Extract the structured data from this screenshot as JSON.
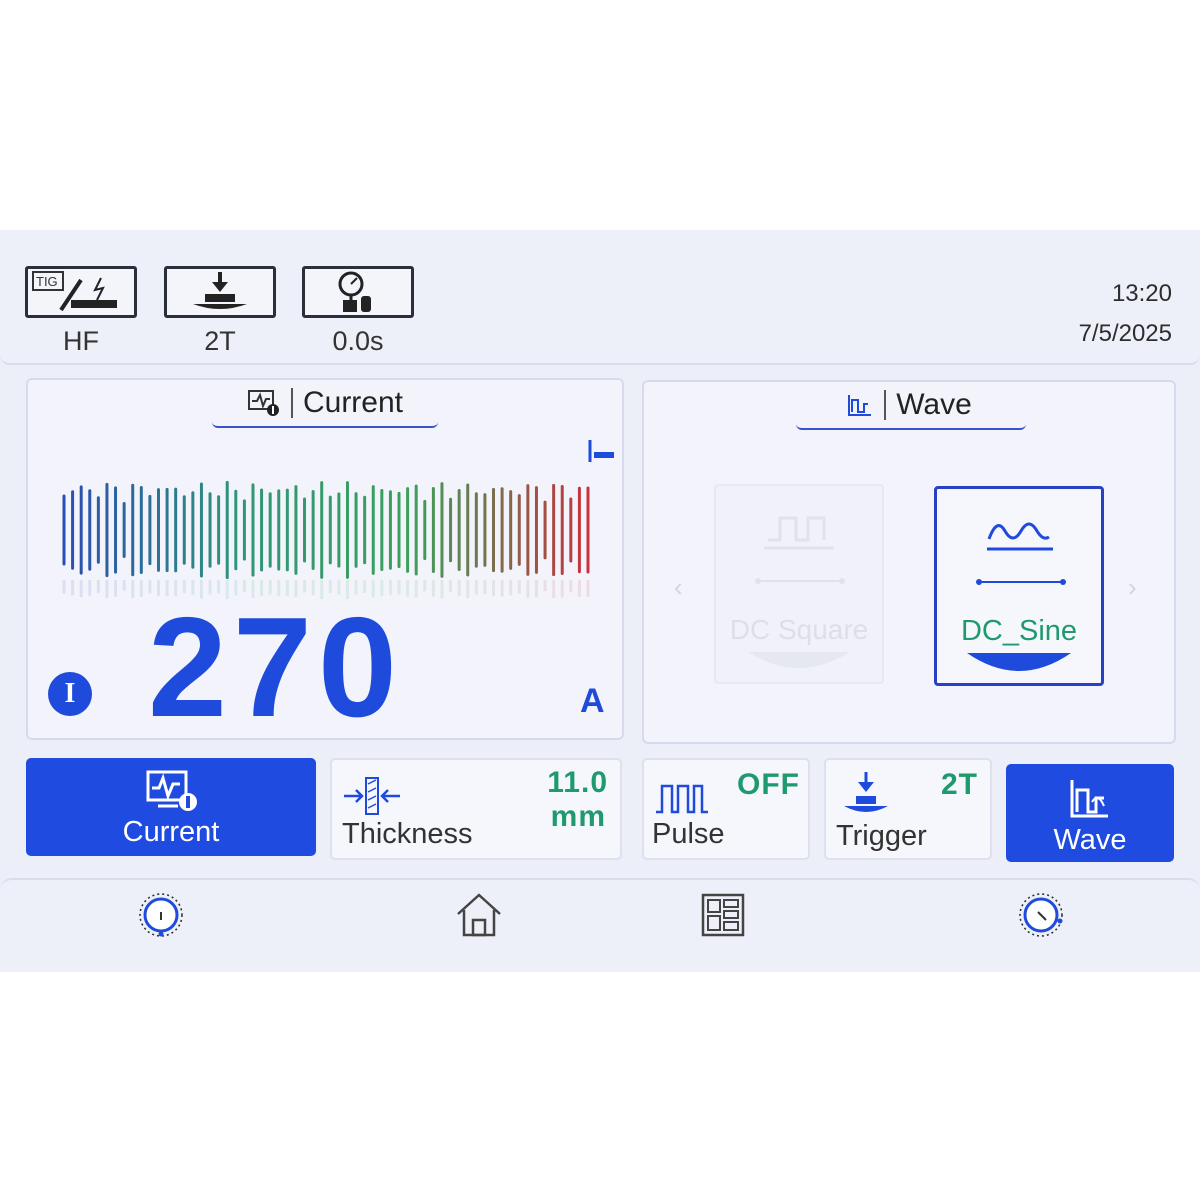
{
  "header": {
    "modes": [
      {
        "icon": "tig-hf-torch-icon",
        "badge": "TIG",
        "label": "HF"
      },
      {
        "icon": "trigger-2t-icon",
        "label": "2T"
      },
      {
        "icon": "gas-timer-icon",
        "label": "0.0s"
      }
    ],
    "time": "13:20",
    "date": "7/5/2025"
  },
  "current_panel": {
    "title": "Current",
    "value": "270",
    "unit": "A",
    "indicator": "I",
    "icon": "current-monitor-icon",
    "torch_icon": "torch-small-icon"
  },
  "wave_panel": {
    "title": "Wave",
    "icon": "wave-icon",
    "options": [
      {
        "label": "DC Square",
        "selected": false,
        "icon": "square-wave-icon"
      },
      {
        "label": "DC_Sine",
        "selected": true,
        "icon": "sine-wave-icon"
      }
    ]
  },
  "tiles": {
    "current": {
      "label": "Current",
      "icon": "current-monitor-icon"
    },
    "thickness": {
      "label": "Thickness",
      "value": "11.0",
      "unit": "mm",
      "icon": "thickness-icon"
    },
    "pulse": {
      "label": "Pulse",
      "value": "OFF",
      "icon": "pulse-icon"
    },
    "trigger": {
      "label": "Trigger",
      "value": "2T",
      "icon": "trigger-icon"
    },
    "wave": {
      "label": "Wave",
      "icon": "wave-icon"
    }
  },
  "colors": {
    "accent": "#1f4be0",
    "value_green": "#1e9a6e",
    "number_blue": "#1f4bdc"
  },
  "bottom_nav": [
    "left-knob-icon",
    "home-icon",
    "menu-grid-icon",
    "right-knob-icon"
  ]
}
